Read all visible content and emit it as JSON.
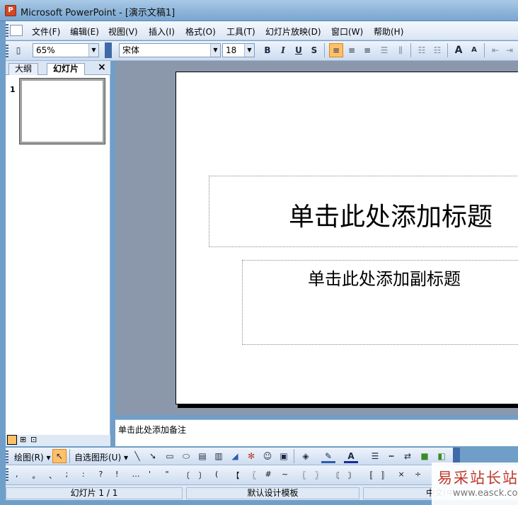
{
  "window": {
    "title": "Microsoft PowerPoint - [演示文稿1]"
  },
  "menu": [
    "文件(F)",
    "编辑(E)",
    "视图(V)",
    "插入(I)",
    "格式(O)",
    "工具(T)",
    "幻灯片放映(D)",
    "窗口(W)",
    "帮助(H)"
  ],
  "toolbar": {
    "zoom": "65%",
    "font": "宋体",
    "size": "18",
    "bold": "B",
    "italic": "I",
    "underline": "U",
    "shadow": "S",
    "grow": "A",
    "shrink": "A"
  },
  "panel": {
    "tab_outline": "大纲",
    "tab_slides": "幻灯片",
    "close": "×",
    "slide_number": "1"
  },
  "slide": {
    "title_placeholder": "单击此处添加标题",
    "subtitle_placeholder": "单击此处添加副标题"
  },
  "notes": {
    "placeholder": "单击此处添加备注"
  },
  "drawbar": {
    "draw": "绘图(R)",
    "autoshapes": "自选图形(U)"
  },
  "symbols": [
    ",",
    "。",
    "、",
    ";",
    ":",
    "?",
    "!",
    "…",
    "'",
    "\"",
    "〔",
    "〕",
    "(",
    "【",
    "〖",
    "#",
    "~",
    "〖",
    "〗",
    "〘",
    "〙",
    "〚",
    "〛",
    "×",
    "÷"
  ],
  "status": {
    "slide": "幻灯片 1 / 1",
    "template": "默认设计模板",
    "lang": "中文(中"
  },
  "watermark": {
    "cn": "易采站长站",
    "en": "www.easck.com"
  },
  "colors": {
    "selected_button": "#ffc06a",
    "title_bar": "#8bb3d8",
    "workspace": "#8b97ab"
  }
}
